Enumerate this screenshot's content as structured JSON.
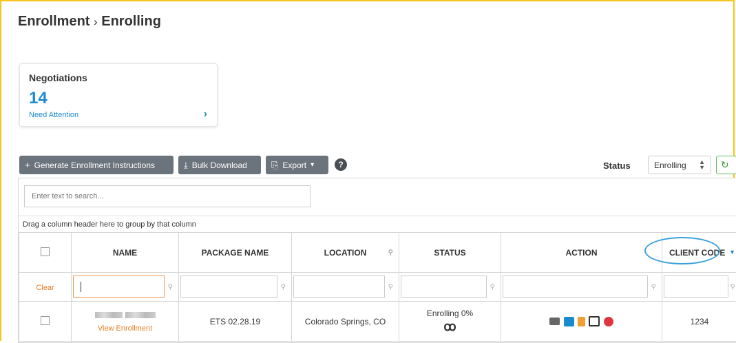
{
  "breadcrumb": {
    "section": "Enrollment",
    "separator": "›",
    "page": "Enrolling"
  },
  "card": {
    "title": "Negotiations",
    "count": "14",
    "subtitle": "Need Attention",
    "chevron": "›"
  },
  "toolbar": {
    "generate_icon": "+",
    "generate_label": "Generate Enrollment Instructions",
    "bulk_icon": "⤓",
    "bulk_label": "Bulk Download",
    "export_icon": "⎘",
    "export_label": "Export",
    "export_caret": "▾",
    "help_icon": "?",
    "status_label": "Status",
    "status_value": "Enrolling",
    "refresh_icon": "↻"
  },
  "grid": {
    "search_placeholder": "Enter text to search...",
    "group_hint": "Drag a column header here to group by that column",
    "columns": [
      "NAME",
      "PACKAGE NAME",
      "LOCATION",
      "STATUS",
      "ACTION",
      "CLIENT CODE"
    ],
    "clear_label": "Clear",
    "row": {
      "link": "View Enrollment",
      "package": "ETS 02.28.19",
      "location": "Colorado Springs, CO",
      "status": "Enrolling 0%",
      "status_icon": "ꝏ",
      "client_code": "1234"
    }
  },
  "colors": {
    "accent": "#1b8bd0",
    "orange": "#e67e22",
    "frame": "#f5c518",
    "button": "#6b737c"
  }
}
